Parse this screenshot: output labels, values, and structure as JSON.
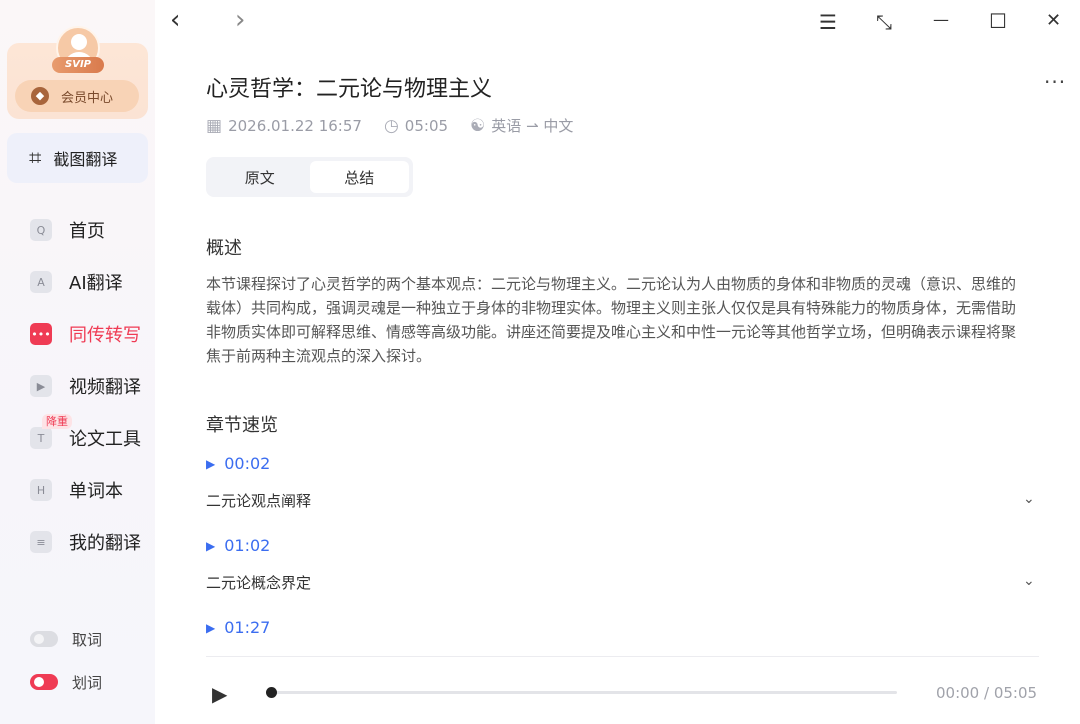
{
  "window": {
    "nav_back": "‹",
    "nav_forward": "›",
    "menu": "☰",
    "restore": "⤡",
    "minimize": "—",
    "maximize": "☐",
    "close": "✕"
  },
  "sidebar": {
    "vip_badge": "SVIP",
    "member_center": "会员中心",
    "screenshot_translate": "截图翻译",
    "items": [
      {
        "label": "首页",
        "icon": "home-icon",
        "glyph": "Q",
        "active": false
      },
      {
        "label": "AI翻译",
        "icon": "ai-icon",
        "glyph": "A",
        "active": false
      },
      {
        "label": "同传转写",
        "icon": "transcribe-icon",
        "glyph": "•••",
        "active": true
      },
      {
        "label": "视频翻译",
        "icon": "video-icon",
        "glyph": "▶",
        "active": false
      },
      {
        "label": "论文工具",
        "icon": "paper-icon",
        "glyph": "T",
        "active": false,
        "badge": "降重"
      },
      {
        "label": "单词本",
        "icon": "wordbook-icon",
        "glyph": "H",
        "active": false
      },
      {
        "label": "我的翻译",
        "icon": "my-translation-icon",
        "glyph": "≡",
        "active": false
      }
    ],
    "toggles": [
      {
        "label": "取词",
        "on": false
      },
      {
        "label": "划词",
        "on": true
      }
    ]
  },
  "doc": {
    "title": "心灵哲学：二元论与物理主义",
    "more": "···",
    "date": "2026.01.22 16:57",
    "duration": "05:05",
    "lang": "英语 ⇀ 中文",
    "tabs": [
      "原文",
      "总结"
    ],
    "active_tab": 1,
    "overview_title": "概述",
    "overview_text": "本节课程探讨了心灵哲学的两个基本观点：二元论与物理主义。二元论认为人由物质的身体和非物质的灵魂（意识、思维的载体）共同构成，强调灵魂是一种独立于身体的非物理实体。物理主义则主张人仅仅是具有特殊能力的物质身体，无需借助非物质实体即可解释思维、情感等高级功能。讲座还简要提及唯心主义和中性一元论等其他哲学立场，但明确表示课程将聚焦于前两种主流观点的深入探讨。",
    "chapters_title": "章节速览",
    "chapters": [
      {
        "time": "00:02",
        "title": "二元论观点阐释"
      },
      {
        "time": "01:02",
        "title": "二元论概念界定"
      },
      {
        "time": "01:27",
        "title": ""
      }
    ]
  },
  "player": {
    "current": "00:00",
    "total": "05:05",
    "separator": " / ",
    "progress": 0
  }
}
